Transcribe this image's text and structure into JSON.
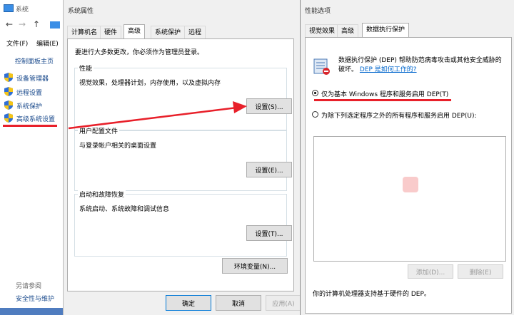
{
  "sys_window": {
    "title": "系统",
    "menu_file": "文件(F)",
    "menu_edit": "编辑(E)",
    "cp_home": "控制面板主页",
    "links": [
      "设备管理器",
      "远程设置",
      "系统保护",
      "高级系统设置"
    ],
    "see_also": "另请参阅",
    "security": "安全性与维护"
  },
  "sys_props": {
    "title": "系统属性",
    "tabs": [
      "计算机名",
      "硬件",
      "高级",
      "系统保护",
      "远程"
    ],
    "admin_note": "要进行大多数更改，你必须作为管理员登录。",
    "perf": {
      "legend": "性能",
      "desc": "视觉效果，处理器计划，内存使用，以及虚拟内存",
      "button": "设置(S)..."
    },
    "profile": {
      "legend": "用户配置文件",
      "desc": "与登录帐户相关的桌面设置",
      "button": "设置(E)..."
    },
    "startup": {
      "legend": "启动和故障恢复",
      "desc": "系统启动、系统故障和调试信息",
      "button": "设置(T)..."
    },
    "env_button": "环境变量(N)...",
    "ok": "确定",
    "cancel": "取消",
    "apply": "应用(A)"
  },
  "perf_opts": {
    "title": "性能选项",
    "tabs": [
      "视觉效果",
      "高级",
      "数据执行保护"
    ],
    "dep_desc": "数据执行保护 (DEP) 帮助防范病毒攻击或其他安全威胁的破坏。",
    "dep_link": "DEP 是如何工作的?",
    "radio1": "仅为基本 Windows 程序和服务启用 DEP(T)",
    "radio2": "为除下列选定程序之外的所有程序和服务启用 DEP(U):",
    "add": "添加(D)...",
    "remove": "删除(E)",
    "support": "你的计算机处理器支持基于硬件的 DEP。"
  },
  "colors": {
    "annotation_red": "#e8202a",
    "link_blue": "#0066cc"
  }
}
